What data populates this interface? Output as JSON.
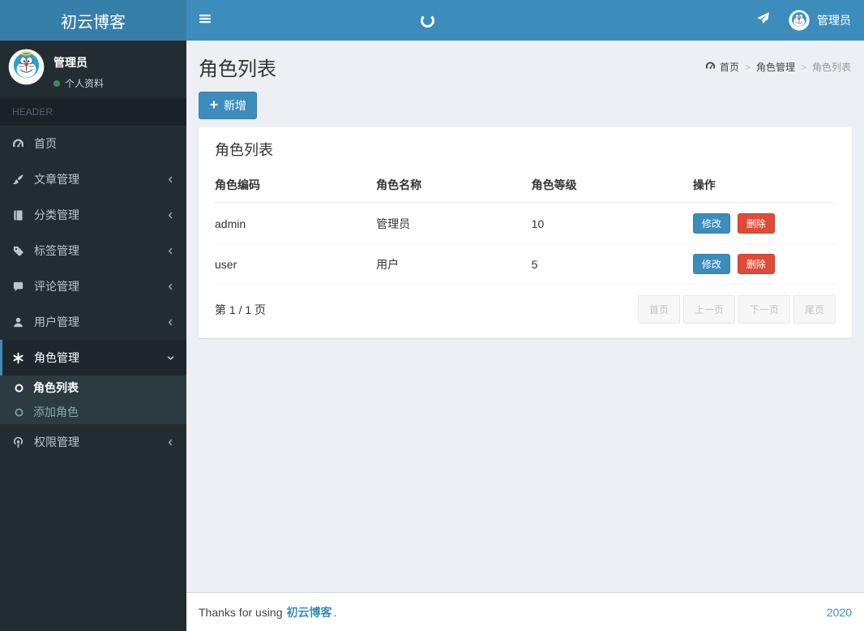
{
  "colors": {
    "navbar": "#3c8dbc",
    "logo_bg": "#367fa9",
    "sidebar_bg": "#222d32",
    "sidebar_section_bg": "#1a2226",
    "active_item_bg": "#1e282c",
    "submenu_bg": "#2c3b41",
    "content_bg": "#ecf0f5",
    "primary": "#3c8dbc",
    "danger": "#dd4b39",
    "status_green": "#3d8b51"
  },
  "brand": {
    "logo_text": "初云博客"
  },
  "navbar": {
    "username": "管理员"
  },
  "sidebar": {
    "user": {
      "name": "管理员",
      "status_label": "个人资料"
    },
    "section_label": "HEADER",
    "items": [
      {
        "label": "首页",
        "icon": "dashboard-icon"
      },
      {
        "label": "文章管理",
        "icon": "paintbrush-icon"
      },
      {
        "label": "分类管理",
        "icon": "book-icon"
      },
      {
        "label": "标签管理",
        "icon": "tag-icon"
      },
      {
        "label": "评论管理",
        "icon": "comment-icon"
      },
      {
        "label": "用户管理",
        "icon": "user-icon"
      },
      {
        "label": "角色管理",
        "icon": "asterisk-icon",
        "children": [
          {
            "label": "角色列表"
          },
          {
            "label": "添加角色"
          }
        ]
      },
      {
        "label": "权限管理",
        "icon": "podcast-icon"
      }
    ]
  },
  "content": {
    "page_title": "角色列表",
    "breadcrumb": {
      "home": "首页",
      "section": "角色管理",
      "current": "角色列表"
    },
    "add_button_label": "新增",
    "panel": {
      "title": "角色列表",
      "table": {
        "headers": [
          "角色编码",
          "角色名称",
          "角色等级",
          "操作"
        ],
        "rows": [
          {
            "code": "admin",
            "name": "管理员",
            "level": "10"
          },
          {
            "code": "user",
            "name": "用户",
            "level": "5"
          }
        ],
        "edit_label": "修改",
        "delete_label": "删除"
      },
      "pagination": {
        "info": "第 1 / 1 页",
        "first": "首页",
        "prev": "上一页",
        "next": "下一页",
        "last": "尾页"
      }
    }
  },
  "footer": {
    "prefix": "Thanks for using",
    "brand": "初云博客",
    "suffix": ".",
    "year": "2020"
  }
}
